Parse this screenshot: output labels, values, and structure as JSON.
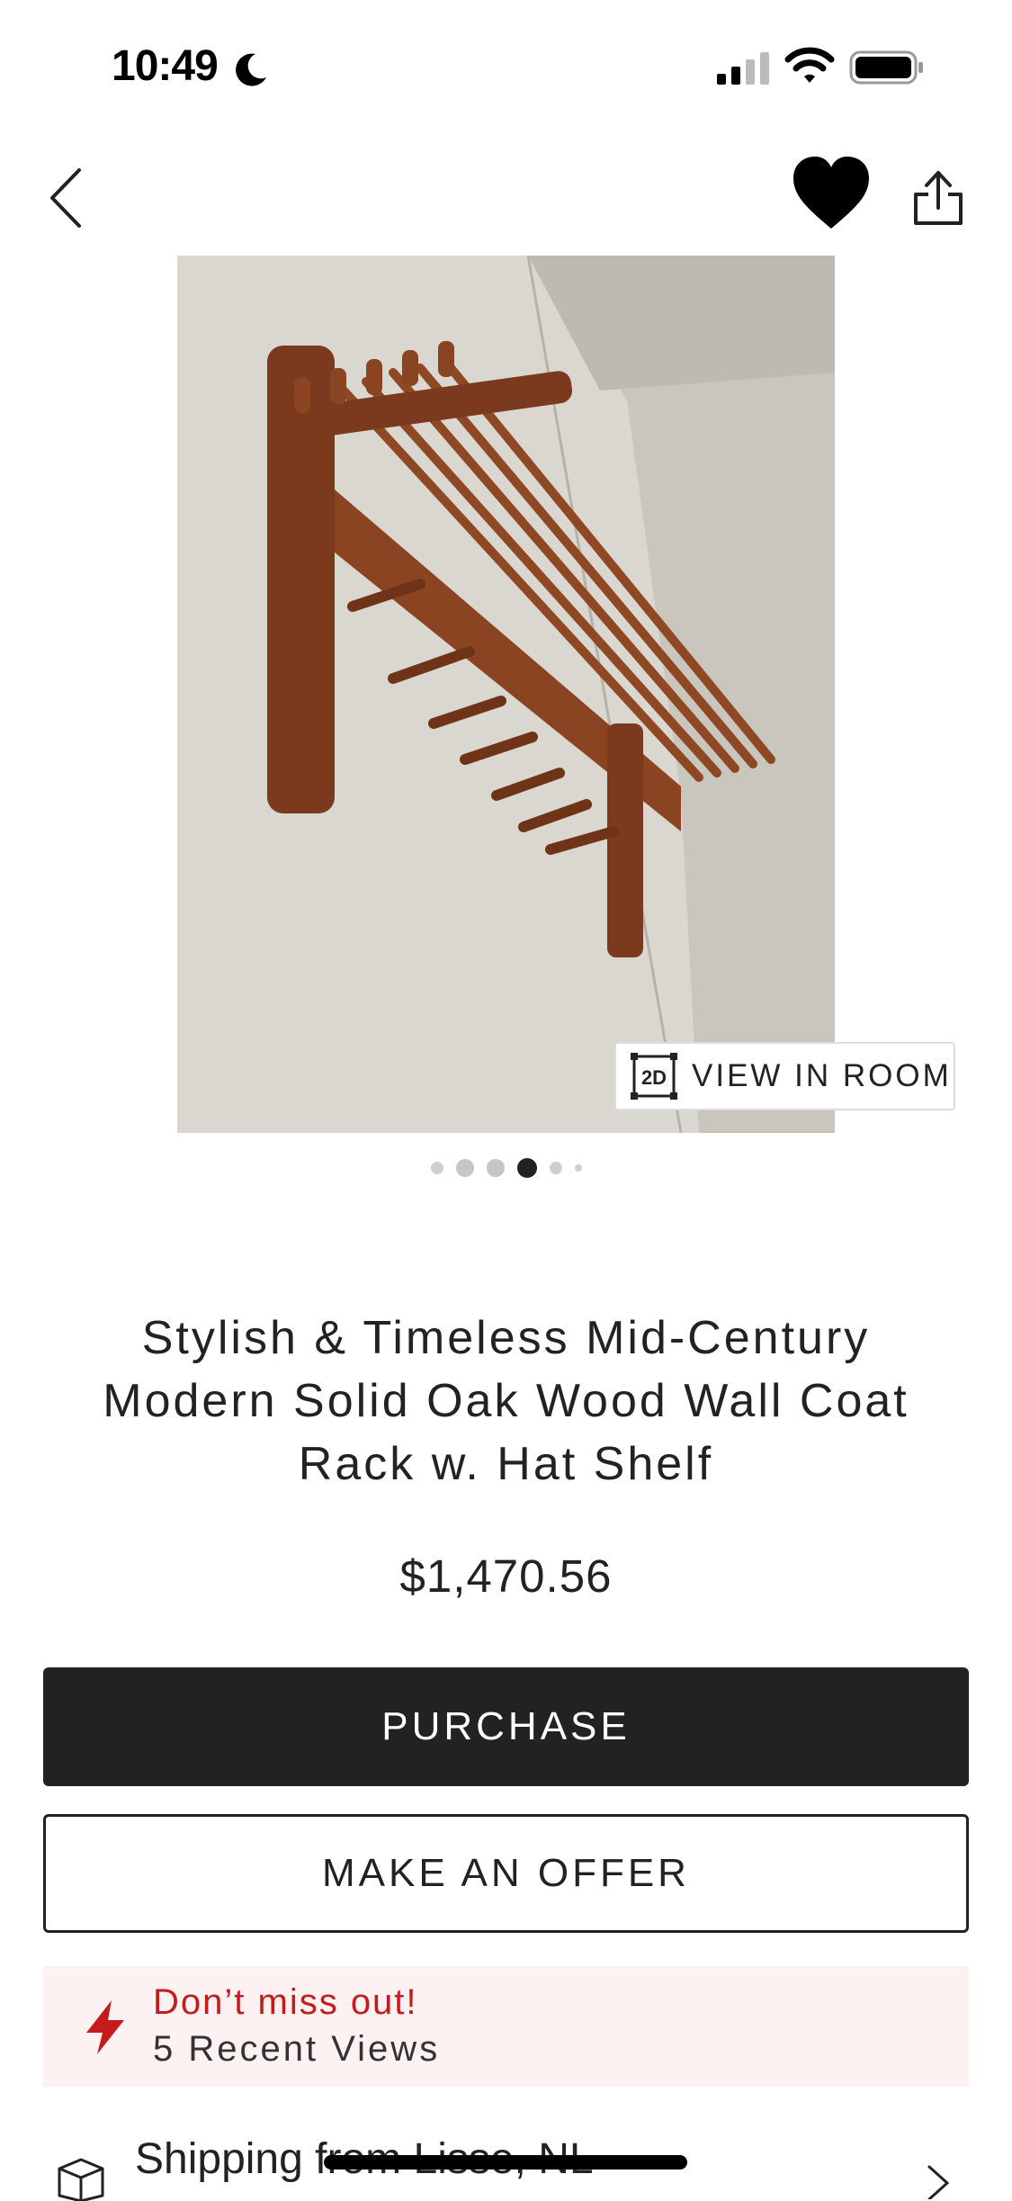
{
  "status_bar": {
    "time": "10:49"
  },
  "product": {
    "title": "Stylish & Timeless Mid-Century Modern Solid Oak Wood Wall Coat Rack w. Hat Shelf",
    "price": "$1,470.56",
    "view_in_room_label": "VIEW IN ROOM",
    "view_in_room_icon_text": "2D",
    "image_count": 6,
    "active_image_index": 3
  },
  "actions": {
    "purchase_label": "PURCHASE",
    "make_offer_label": "MAKE AN OFFER"
  },
  "urgency": {
    "title": "Don’t miss out!",
    "subtitle": "5 Recent Views"
  },
  "shipping": {
    "label": "Shipping from Lisse, NL"
  },
  "icons": {
    "back": "chevron-left-icon",
    "favorite": "heart-icon",
    "share": "share-icon",
    "urgency": "lightning-bolt-icon",
    "shipping": "box-icon",
    "shipping_chevron": "chevron-right-icon"
  },
  "colors": {
    "primary_button": "#222222",
    "urgency_background": "#fdf1f1",
    "urgency_accent": "#c41c1c"
  }
}
